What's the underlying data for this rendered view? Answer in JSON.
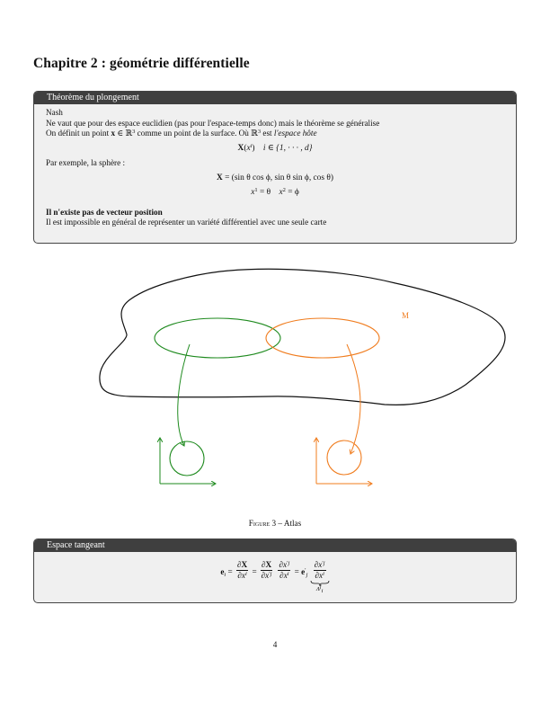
{
  "chapter": {
    "title": "Chapitre 2 : géométrie différentielle"
  },
  "theorem_box": {
    "header": "Théorème du plongement",
    "line1": "Nash",
    "line2": "Ne vaut que pour des espace euclidien (pas pour l'espace-temps donc) mais le théorème se généralise",
    "line3_prefix": "On définit un point",
    "line3_middle": "comme un point de la surface. Où",
    "line3_suffix": "est",
    "line3_emph": "l'espace hôte",
    "eq1_range": "i ∈ {1, · · · , d}",
    "line4": "Par exemple, la sphère :",
    "eq2_rhs": "(sin θ cos ϕ, sin θ sin ϕ, cos θ)",
    "eq3_a": "= θ",
    "eq3_b": "= ϕ",
    "bold_heading": "Il n'existe pas de vecteur position",
    "line5": "Il est impossible en général de représenter un variété différentiel avec une seule carte"
  },
  "figure": {
    "manifold_label": "M",
    "caption_label": "Figure 3",
    "caption_sep": " – ",
    "caption_text": "Atlas",
    "colors": {
      "left_chart": "#1e8a1e",
      "right_chart": "#f07c1e",
      "manifold": "#111111",
      "label": "#f07c1e"
    }
  },
  "tangent_box": {
    "header": "Espace tangeant",
    "brace_label": "Λ"
  },
  "page": {
    "number": "4"
  }
}
